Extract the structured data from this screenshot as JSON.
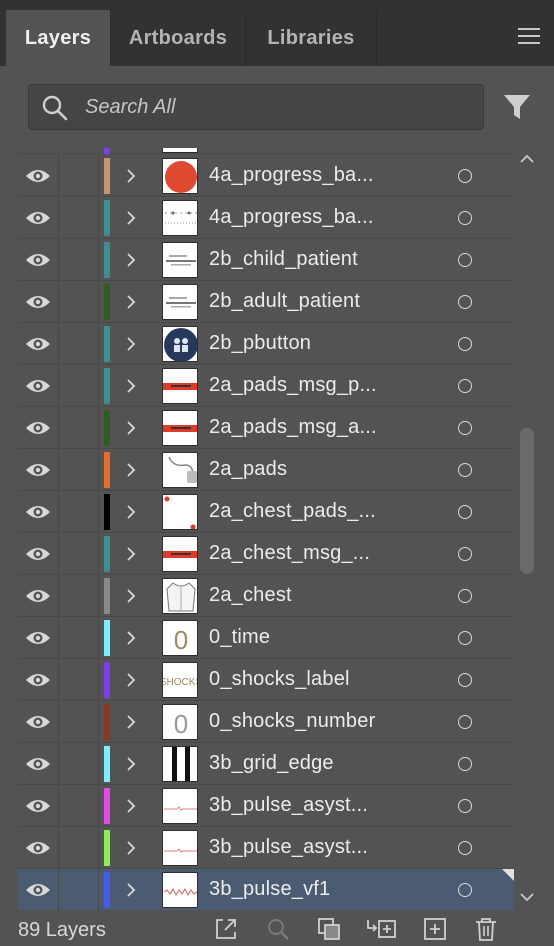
{
  "tabs": [
    {
      "label": "Layers",
      "active": true
    },
    {
      "label": "Artboards",
      "active": false
    },
    {
      "label": "Libraries",
      "active": false
    }
  ],
  "search": {
    "placeholder": "Search All",
    "value": ""
  },
  "layers": [
    {
      "name": "4a_progress_ba...",
      "color": "#c7956a",
      "thumb": "red-circle-icon",
      "selected": false
    },
    {
      "name": "4a_progress_ba...",
      "color": "#3f8e90",
      "thumb": "dotted-line-icon",
      "selected": false
    },
    {
      "name": "2b_child_patient",
      "color": "#3f8e90",
      "thumb": "text-block-icon",
      "selected": false
    },
    {
      "name": "2b_adult_patient",
      "color": "#2e5e24",
      "thumb": "text-block-icon",
      "selected": false
    },
    {
      "name": "2b_pbutton",
      "color": "#3f8e90",
      "thumb": "patient-button-icon",
      "selected": false
    },
    {
      "name": "2a_pads_msg_p...",
      "color": "#3f8e90",
      "thumb": "red-banner-icon",
      "selected": false
    },
    {
      "name": "2a_pads_msg_a...",
      "color": "#2e5e24",
      "thumb": "red-banner-icon",
      "selected": false
    },
    {
      "name": "2a_pads",
      "color": "#e86a2c",
      "thumb": "pads-cable-icon",
      "selected": false
    },
    {
      "name": "2a_chest_pads_...",
      "color": "#000000",
      "thumb": "red-dot-corner-icon",
      "selected": false
    },
    {
      "name": "2a_chest_msg_...",
      "color": "#3f8e90",
      "thumb": "red-banner-icon",
      "selected": false
    },
    {
      "name": "2a_chest",
      "color": "#8a8a8a",
      "thumb": "shirt-icon",
      "selected": false
    },
    {
      "name": "0_time",
      "color": "#7fefff",
      "thumb": "digit-zero-icon",
      "selected": false
    },
    {
      "name": "0_shocks_label",
      "color": "#7a3ff0",
      "thumb": "shocks-text-icon",
      "selected": false
    },
    {
      "name": "0_shocks_number",
      "color": "#8a3a22",
      "thumb": "digit-zero-gray-icon",
      "selected": false
    },
    {
      "name": "3b_grid_edge",
      "color": "#7fefff",
      "thumb": "grid-edge-icon",
      "selected": false
    },
    {
      "name": "3b_pulse_asyst...",
      "color": "#e64ae6",
      "thumb": "flat-pulse-icon",
      "selected": false
    },
    {
      "name": "3b_pulse_asyst...",
      "color": "#8aee5a",
      "thumb": "flat-pulse-icon",
      "selected": false
    },
    {
      "name": "3b_pulse_vf1",
      "color": "#4a5af0",
      "thumb": "vf-pulse-icon",
      "selected": true
    }
  ],
  "thumb_text": {
    "shocks": "SHOCKS",
    "zero": "0"
  },
  "footer": {
    "count_label": "89 Layers"
  },
  "icons": {
    "eye": "eye-icon",
    "chevron": "chevron-right-icon",
    "target": "target-circle-icon",
    "search": "search-icon",
    "filter": "filter-icon",
    "menu": "hamburger-menu-icon",
    "footer": [
      "export-icon",
      "locate-object-icon",
      "clipping-mask-icon",
      "new-sublayer-icon",
      "new-layer-icon",
      "trash-icon"
    ]
  }
}
